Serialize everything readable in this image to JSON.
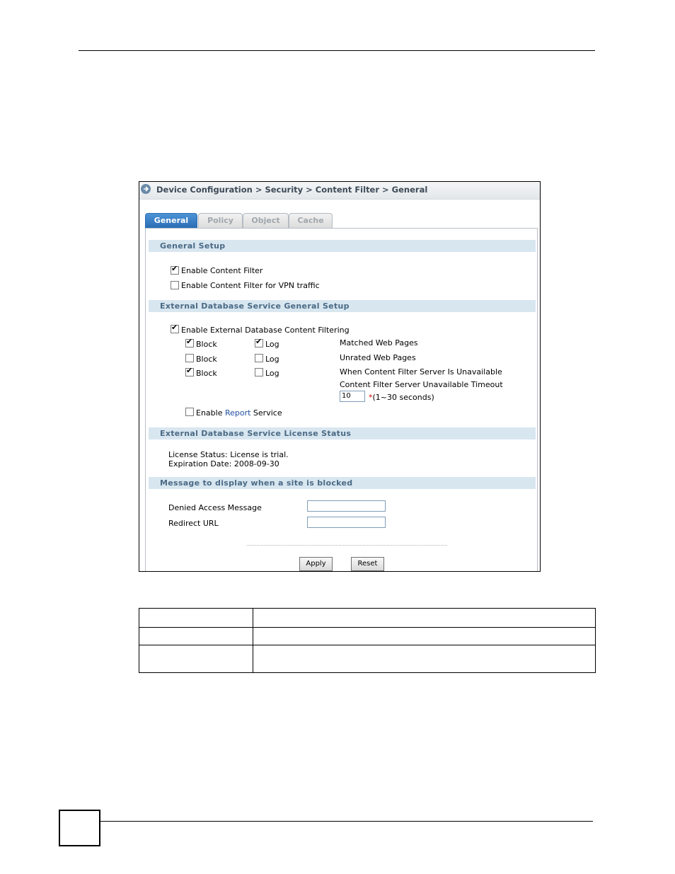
{
  "breadcrumb": "Device Configuration > Security > Content Filter > General",
  "tabs": [
    {
      "label": "General",
      "active": true
    },
    {
      "label": "Policy",
      "active": false
    },
    {
      "label": "Object",
      "active": false
    },
    {
      "label": "Cache",
      "active": false
    }
  ],
  "general_setup": {
    "title": "General Setup",
    "enable_content_filter": {
      "label": "Enable Content Filter",
      "checked": true
    },
    "enable_vpn": {
      "label": "Enable Content Filter for VPN traffic",
      "checked": false
    }
  },
  "external_db": {
    "title": "External Database Service General Setup",
    "enable_filtering": {
      "label": "Enable External Database Content Filtering",
      "checked": true
    },
    "rows": [
      {
        "block_label": "Block",
        "block_checked": true,
        "log_label": "Log",
        "log_checked": true,
        "description": "Matched Web Pages"
      },
      {
        "block_label": "Block",
        "block_checked": false,
        "log_label": "Log",
        "log_checked": false,
        "description": "Unrated Web Pages"
      },
      {
        "block_label": "Block",
        "block_checked": true,
        "log_label": "Log",
        "log_checked": false,
        "description": "When Content Filter Server Is Unavailable"
      }
    ],
    "timeout_label": "Content Filter Server Unavailable Timeout",
    "timeout_value": "10",
    "timeout_required": "*",
    "timeout_hint": "(1~30 seconds)",
    "report": {
      "prefix": "Enable ",
      "link": "Report",
      "suffix": " Service",
      "checked": false
    }
  },
  "license": {
    "title": "External Database Service License Status",
    "status": "License Status: License is trial.",
    "expiration": "Expiration Date: 2008-09-30"
  },
  "message": {
    "title": "Message to display when a site is blocked",
    "denied_label": "Denied Access Message",
    "denied_value": "",
    "redirect_label": "Redirect URL",
    "redirect_value": ""
  },
  "buttons": {
    "apply": "Apply",
    "reset": "Reset"
  },
  "colors": {
    "tab_active": "#2a6cb5",
    "section_bg": "#d8e6f0",
    "section_text": "#4a6a85",
    "link": "#1f4fa0",
    "required": "#d40000"
  }
}
